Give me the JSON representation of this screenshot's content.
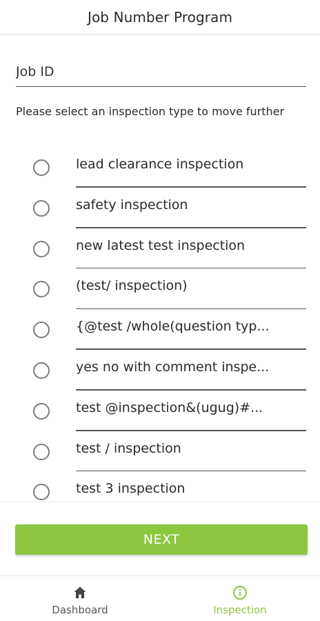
{
  "header": {
    "title": "Job Number Program"
  },
  "job_id": {
    "placeholder": "Job ID",
    "value": ""
  },
  "instruction": "Please select an inspection type to move further",
  "inspection_options": [
    {
      "label": "lead clearance inspection",
      "selected": false
    },
    {
      "label": "safety inspection",
      "selected": false
    },
    {
      "label": "new latest test inspection",
      "selected": false
    },
    {
      "label": "(test/ inspection)",
      "selected": false
    },
    {
      "label": "{@test /whole(question typ...",
      "selected": false
    },
    {
      "label": "yes no with comment inspe...",
      "selected": false
    },
    {
      "label": "test @inspection&(ugug)#...",
      "selected": false
    },
    {
      "label": "test / inspection",
      "selected": false
    },
    {
      "label": "test 3 inspection",
      "selected": false
    }
  ],
  "next_button": {
    "label": "NEXT"
  },
  "bottom_nav": {
    "items": [
      {
        "label": "Dashboard",
        "icon": "home-icon",
        "active": false
      },
      {
        "label": "Inspection",
        "icon": "info-icon",
        "active": true
      }
    ]
  },
  "colors": {
    "accent": "#8dc63f",
    "text": "#2a2a2a",
    "divider": "#555555",
    "inactive_nav": "#555555"
  }
}
